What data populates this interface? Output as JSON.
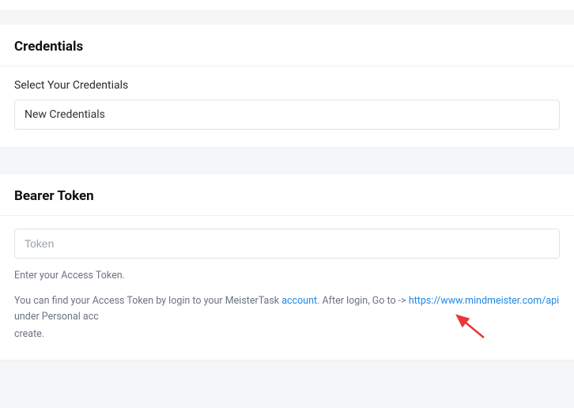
{
  "credentials": {
    "title": "Credentials",
    "select_label": "Select Your Credentials",
    "select_value": "New Credentials"
  },
  "bearer": {
    "title": "Bearer Token",
    "input_placeholder": "Token",
    "helper1": "Enter your Access Token.",
    "helper2_prefix": "You can find your Access Token by login to your MeisterTask ",
    "account_link": "account",
    "helper2_mid": ". After login, Go to -> ",
    "api_link": "https://www.mindmeister.com/api",
    "helper2_suffix": " under Personal acc",
    "helper3": "create."
  }
}
